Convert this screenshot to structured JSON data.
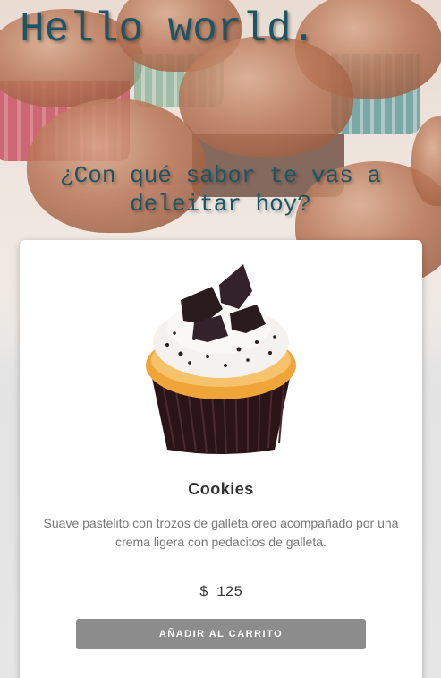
{
  "header": {
    "title": "Hello world.",
    "subtitle": "¿Con qué sabor te vas a deleitar hoy?"
  },
  "background": {
    "icon": "cupcakes-photo"
  },
  "product": {
    "image_icon": "oreo-cupcake-image",
    "name": "Cookies",
    "description": "Suave pastelito con trozos de galleta oreo acompañado por una crema ligera con pedacitos de galleta.",
    "price": "$ 125",
    "add_to_cart_label": "AÑADIR AL CARRITO"
  },
  "colors": {
    "heading": "#1d5566",
    "button": "#8c8c8c",
    "card": "#ffffff"
  }
}
